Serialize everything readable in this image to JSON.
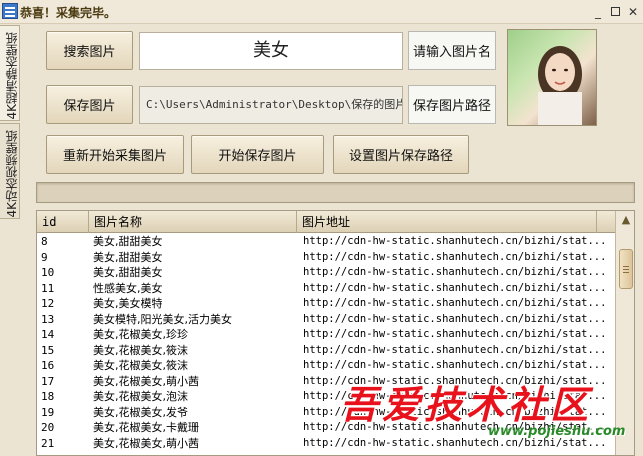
{
  "window": {
    "title": "恭喜！采集完毕。",
    "minimize": "_",
    "close": "✕"
  },
  "tabs": [
    {
      "label": "4K超清静态壁纸"
    },
    {
      "label": "4K动态视频壁纸"
    }
  ],
  "controls": {
    "search_button": "搜索图片",
    "search_value": "美女",
    "name_hint_button": "请输入图片名",
    "save_button": "保存图片",
    "save_path": "C:\\Users\\Administrator\\Desktop\\保存的图片",
    "save_path_button": "保存图片路径",
    "restart_button": "重新开始采集图片",
    "start_save_button": "开始保存图片",
    "set_path_button": "设置图片保存路径"
  },
  "progress": {
    "value": 0
  },
  "table": {
    "headers": {
      "id": "id",
      "name": "图片名称",
      "url": "图片地址"
    },
    "rows": [
      {
        "id": "8",
        "name": "美女,甜甜美女",
        "url": "http://cdn-hw-static.shanhutech.cn/bizhi/stat..."
      },
      {
        "id": "9",
        "name": "美女,甜甜美女",
        "url": "http://cdn-hw-static.shanhutech.cn/bizhi/stat..."
      },
      {
        "id": "10",
        "name": "美女,甜甜美女",
        "url": "http://cdn-hw-static.shanhutech.cn/bizhi/stat..."
      },
      {
        "id": "11",
        "name": "性感美女,美女",
        "url": "http://cdn-hw-static.shanhutech.cn/bizhi/stat..."
      },
      {
        "id": "12",
        "name": "美女,美女模特",
        "url": "http://cdn-hw-static.shanhutech.cn/bizhi/stat..."
      },
      {
        "id": "13",
        "name": "美女模特,阳光美女,活力美女",
        "url": "http://cdn-hw-static.shanhutech.cn/bizhi/stat..."
      },
      {
        "id": "14",
        "name": "美女,花椒美女,珍珍",
        "url": "http://cdn-hw-static.shanhutech.cn/bizhi/stat..."
      },
      {
        "id": "15",
        "name": "美女,花椒美女,筱沫",
        "url": "http://cdn-hw-static.shanhutech.cn/bizhi/stat..."
      },
      {
        "id": "16",
        "name": "美女,花椒美女,筱沫",
        "url": "http://cdn-hw-static.shanhutech.cn/bizhi/stat..."
      },
      {
        "id": "17",
        "name": "美女,花椒美女,萌小茜",
        "url": "http://cdn-hw-static.shanhutech.cn/bizhi/stat..."
      },
      {
        "id": "18",
        "name": "美女,花椒美女,泡沫",
        "url": "http://cdn-hw-static.shanhutech.cn/bizhi/stat..."
      },
      {
        "id": "19",
        "name": "美女,花椒美女,发爷",
        "url": "http://cdn-hw-static.shanhutech.cn/bizhi/stat..."
      },
      {
        "id": "20",
        "name": "美女,花椒美女,卡戴珊",
        "url": "http://cdn-hw-static.shanhutech.cn/bizhi/stat..."
      },
      {
        "id": "21",
        "name": "美女,花椒美女,萌小茜",
        "url": "http://cdn-hw-static.shanhutech.cn/bizhi/stat..."
      }
    ]
  },
  "watermark": {
    "text": "吾爱技术社区",
    "url": "www.pojieshu.com"
  },
  "icons": {
    "scroll_up": "▲"
  }
}
